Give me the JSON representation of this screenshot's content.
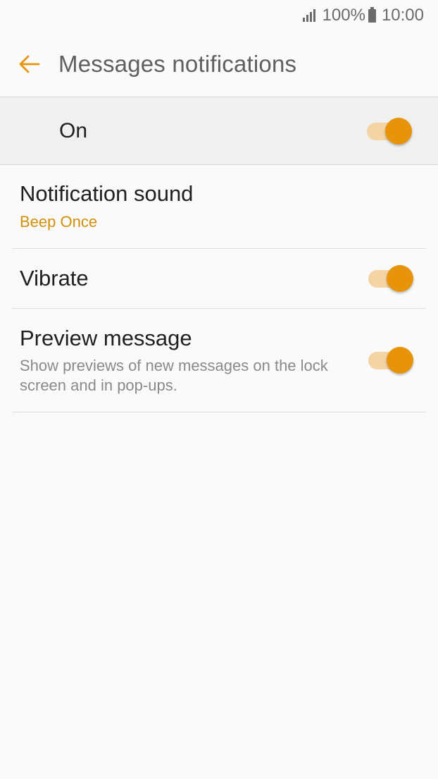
{
  "status_bar": {
    "battery_percent": "100%",
    "time": "10:00"
  },
  "app_bar": {
    "title": "Messages notifications"
  },
  "master": {
    "label": "On",
    "enabled": true
  },
  "settings": {
    "notification_sound": {
      "title": "Notification sound",
      "value": "Beep Once"
    },
    "vibrate": {
      "title": "Vibrate",
      "enabled": true
    },
    "preview_message": {
      "title": "Preview message",
      "summary": "Show previews of new messages on the lock screen and in pop-ups.",
      "enabled": true
    }
  },
  "colors": {
    "accent": "#e8940a",
    "accent_text": "#d18f0b",
    "switch_track_on": "#f4d4a4",
    "background": "#fafafa",
    "master_row_bg": "#f0f0f0"
  },
  "icons": {
    "back": "arrow-left-icon",
    "signal": "signal-icon",
    "battery": "battery-icon"
  }
}
